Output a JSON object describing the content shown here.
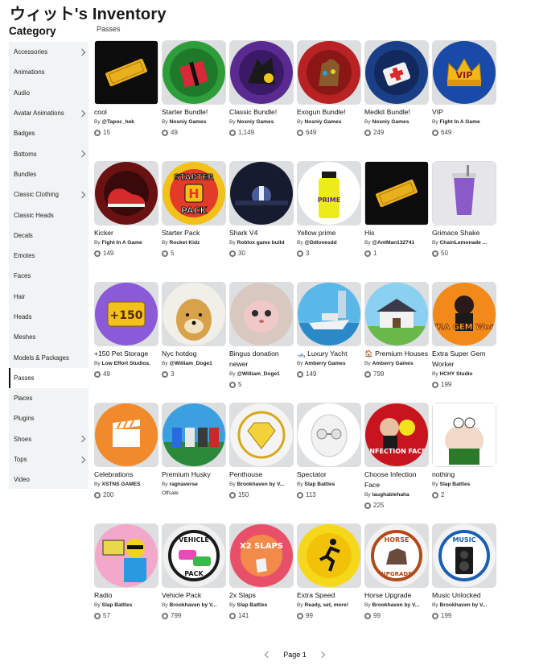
{
  "page": {
    "title": "ウィット's Inventory"
  },
  "category": {
    "heading": "Category",
    "items": [
      {
        "label": "Accessories",
        "has_children": true
      },
      {
        "label": "Animations",
        "has_children": false
      },
      {
        "label": "Audio",
        "has_children": false
      },
      {
        "label": "Avatar Animations",
        "has_children": true
      },
      {
        "label": "Badges",
        "has_children": false
      },
      {
        "label": "Bottoms",
        "has_children": true
      },
      {
        "label": "Bundles",
        "has_children": false
      },
      {
        "label": "Classic Clothing",
        "has_children": true
      },
      {
        "label": "Classic Heads",
        "has_children": false
      },
      {
        "label": "Decals",
        "has_children": false
      },
      {
        "label": "Emotes",
        "has_children": false
      },
      {
        "label": "Faces",
        "has_children": false
      },
      {
        "label": "Hair",
        "has_children": false
      },
      {
        "label": "Heads",
        "has_children": false
      },
      {
        "label": "Meshes",
        "has_children": false
      },
      {
        "label": "Models & Packages",
        "has_children": false
      },
      {
        "label": "Passes",
        "has_children": false,
        "active": true
      },
      {
        "label": "Places",
        "has_children": false
      },
      {
        "label": "Plugins",
        "has_children": false
      },
      {
        "label": "Shoes",
        "has_children": true
      },
      {
        "label": "Tops",
        "has_children": true
      },
      {
        "label": "Video",
        "has_children": false
      }
    ]
  },
  "section": {
    "label": "Passes"
  },
  "by_label": "By",
  "items": [
    {
      "name": "cool",
      "creator": "@Tapoc_hek",
      "count": "15",
      "icon": "gold-ticket-icon",
      "color": "#111111"
    },
    {
      "name": "Starter Bundle!",
      "creator": "Nosniy Games",
      "count": "49",
      "icon": "gift-box-icon",
      "color": "#2e8b2e"
    },
    {
      "name": "Classic Bundle!",
      "creator": "Nosniy Games",
      "count": "1,149",
      "icon": "bundle-icon",
      "color": "#5b2a8a"
    },
    {
      "name": "Exogun Bundle!",
      "creator": "Nosniy Games",
      "count": "649",
      "icon": "gauntlet-icon",
      "color": "#c42828"
    },
    {
      "name": "Medkit Bundle!",
      "creator": "Nosniy Games",
      "count": "249",
      "icon": "medkit-icon",
      "color": "#1d4f9c"
    },
    {
      "name": "VIP",
      "creator": "Fight In A Game",
      "count": "649",
      "icon": "crown-icon",
      "color": "#1c4fa8"
    },
    {
      "name": "Kicker",
      "creator": "Fight In A Game",
      "count": "149",
      "icon": "shoe-icon",
      "color": "#7a1414"
    },
    {
      "name": "Starter Pack",
      "creator": "Rocket Kidz",
      "count": "5",
      "icon": "starter-pack-icon",
      "color": "#e23a2a"
    },
    {
      "name": "Shark V4",
      "creator": "Roblox game build",
      "count": "30",
      "icon": "shark-icon",
      "color": "#1a2238"
    },
    {
      "name": "Yellow prime",
      "creator": "@Ddlovesdd",
      "count": "3",
      "icon": "bottle-icon",
      "color": "#f2ef2a"
    },
    {
      "name": "His",
      "creator": "@AntMan132741",
      "count": "1",
      "icon": "gold-ticket-icon",
      "color": "#111111"
    },
    {
      "name": "Grimace Shake",
      "creator": "ChainLemonade ...",
      "count": "50",
      "icon": "shake-icon",
      "color": "#e9e9ec"
    },
    {
      "name": "+150 Pet Storage",
      "creator": "Low Effort Studios.",
      "count": "49",
      "icon": "pet-storage-icon",
      "color": "#8a5bd6"
    },
    {
      "name": "Nyc hotdog",
      "creator": "@William_Doge1",
      "count": "3",
      "icon": "doge-icon",
      "color": "#c9a25a"
    },
    {
      "name": "Bingus donation newer",
      "creator": "@William_Doge1",
      "count": "5",
      "icon": "cat-icon",
      "color": "#e8c8c8"
    },
    {
      "name": "🛥️ Luxury Yacht",
      "creator": "Amberry Games",
      "count": "149",
      "icon": "yacht-icon",
      "color": "#3fa8e0"
    },
    {
      "name": "🏠 Premium Houses",
      "creator": "Amberry Games",
      "count": "799",
      "icon": "house-icon",
      "color": "#6cbfe8"
    },
    {
      "name": "Extra Super Gem Worker",
      "creator": "HCHY Studio",
      "count": "199",
      "icon": "gem-worker-icon",
      "color": "#f27b1a"
    },
    {
      "name": "Celebrations",
      "creator": "XSTNS GAMES",
      "count": "200",
      "icon": "clapper-icon",
      "color": "#f0802a"
    },
    {
      "name": "Premium Husky",
      "creator": "ragnaverse",
      "count": "",
      "offsale": "Offsale",
      "icon": "husky-icon",
      "color": "#2a8a4a"
    },
    {
      "name": "Penthouse",
      "creator": "Brookhaven by V...",
      "count": "150",
      "icon": "diamond-icon",
      "color": "#f2f2f2"
    },
    {
      "name": "Spectator",
      "creator": "Slap Battles",
      "count": "113",
      "icon": "mask-icon",
      "color": "#eeeeee"
    },
    {
      "name": "Choose Infection Face",
      "creator": "laughablehaha",
      "count": "225",
      "icon": "infection-icon",
      "color": "#c8141e"
    },
    {
      "name": "nothing",
      "creator": "Slap Battles",
      "count": "2",
      "icon": "character-icon",
      "color": "#ffffff"
    },
    {
      "name": "Radio",
      "creator": "Slap Battles",
      "count": "57",
      "icon": "radio-icon",
      "color": "#f2a6c8"
    },
    {
      "name": "Vehicle Pack",
      "creator": "Brookhaven by V...",
      "count": "799",
      "icon": "vehicle-icon",
      "color": "#2a2a2a"
    },
    {
      "name": "2x Slaps",
      "creator": "Slap Battles",
      "count": "141",
      "icon": "slap-icon",
      "color": "#e84a64"
    },
    {
      "name": "Extra Speed",
      "creator": "Ready, set, more!",
      "count": "99",
      "icon": "running-man-icon",
      "color": "#f4d21a"
    },
    {
      "name": "Horse Upgrade",
      "creator": "Brookhaven by V...",
      "count": "99",
      "icon": "horse-icon",
      "color": "#b04a1a"
    },
    {
      "name": "Music Unlocked",
      "creator": "Brookhaven by V...",
      "count": "199",
      "icon": "speaker-icon",
      "color": "#1b5fb4"
    }
  ],
  "art": {
    "vip": "VIP",
    "starter_top": "STARTER",
    "starter_bottom": "PACK",
    "prime": "PRIME",
    "plus150": "+150",
    "gem": "EXTRA GEM Worker",
    "infection": "INFECTION FACE",
    "vehicle_top": "VEHICLE",
    "vehicle_bottom": "PACK",
    "slaps": "X2 SLAPS",
    "horse_top": "HORSE",
    "horse_bottom": "UPGRADE",
    "music": "MUSIC"
  },
  "pager": {
    "label": "Page 1"
  }
}
